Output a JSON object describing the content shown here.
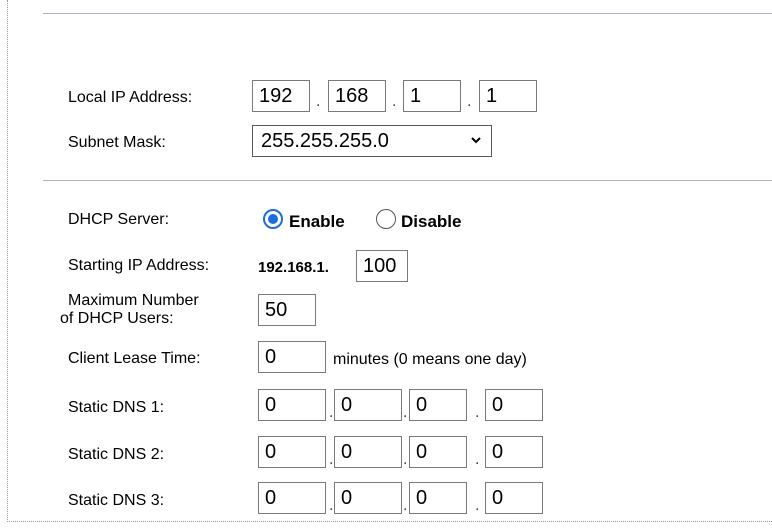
{
  "lan": {
    "local_ip_label": "Local IP Address:",
    "local_ip": [
      "192",
      "168",
      "1",
      "1"
    ],
    "subnet_label": "Subnet Mask:",
    "subnet_value": "255.255.255.0",
    "subnet_options": [
      "255.255.255.0"
    ]
  },
  "dhcp": {
    "server_label": "DHCP Server:",
    "enable_label": "Enable",
    "disable_label": "Disable",
    "selected": "Enable",
    "start_label": "Starting IP Address:",
    "start_prefix": "192.168.1.",
    "start_value": "100",
    "max_label_line1": "Maximum Number",
    "max_label_line2": "of  DHCP Users:",
    "max_value": "50",
    "lease_label": "Client Lease Time:",
    "lease_value": "0",
    "lease_hint": "minutes (0 means one day)",
    "dns1_label": "Static DNS 1:",
    "dns1": [
      "0",
      "0",
      "0",
      "0"
    ],
    "dns2_label": "Static DNS 2:",
    "dns2": [
      "0",
      "0",
      "0",
      "0"
    ],
    "dns3_label": "Static DNS 3:",
    "dns3": [
      "0",
      "0",
      "0",
      "0"
    ],
    "separator": "."
  },
  "colors": {
    "accent": "#1a6fe0",
    "rule": "#a9b3cf",
    "input_border": "#7a7a7a"
  },
  "icons": {
    "dropdown": "chevron-down-icon"
  }
}
